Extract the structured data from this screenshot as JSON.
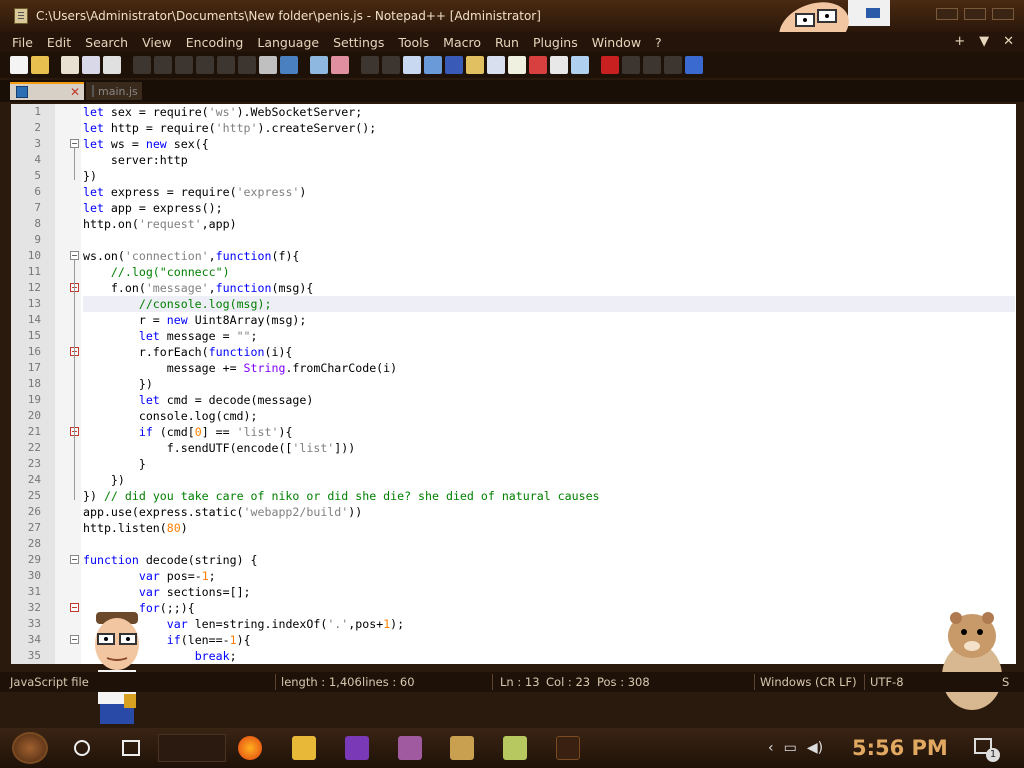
{
  "colors": {
    "accent": "#f39c12",
    "keyword": "#0000ff",
    "string": "#808080",
    "comment": "#008000",
    "number": "#ff8000",
    "builtin": "#8000ff"
  },
  "window": {
    "title": "C:\\Users\\Administrator\\Documents\\New folder\\penis.js - Notepad++ [Administrator]"
  },
  "menu": [
    "File",
    "Edit",
    "Search",
    "View",
    "Encoding",
    "Language",
    "Settings",
    "Tools",
    "Macro",
    "Run",
    "Plugins",
    "Window",
    "?"
  ],
  "menu_right": {
    "plus": "+",
    "dropdown": "▼",
    "close": "✕"
  },
  "tabs": [
    {
      "label": "",
      "active": true
    },
    {
      "label": "main.js",
      "active": false
    }
  ],
  "editor": {
    "current_line": 13,
    "lines": [
      "let sex = require('ws').WebSocketServer;",
      "let http = require('http').createServer();",
      "let ws = new sex({",
      "    server:http",
      "})",
      "let express = require('express')",
      "let app = express();",
      "http.on('request',app)",
      "",
      "ws.on('connection',function(f){",
      "    //.log(\"connecc\")",
      "    f.on('message',function(msg){",
      "        //console.log(msg);",
      "        r = new Uint8Array(msg);",
      "        let message = \"\";",
      "        r.forEach(function(i){",
      "            message += String.fromCharCode(i)",
      "        })",
      "        let cmd = decode(message)",
      "        console.log(cmd);",
      "        if (cmd[0] == 'list'){",
      "            f.sendUTF(encode(['list']))",
      "        }",
      "    })",
      "}) // did you take care of niko or did she die? she died of natural causes",
      "app.use(express.static('webapp2/build'))",
      "http.listen(80)",
      "",
      "function decode(string) {",
      "        var pos=-1;",
      "        var sections=[];",
      "        for(;;){",
      "            var len=string.indexOf('.',pos+1);",
      "            if(len==-1){",
      "                break;"
    ]
  },
  "status": {
    "language": "JavaScript file",
    "length": "length : 1,406",
    "lines": "lines : 60",
    "ln": "Ln : 13",
    "col": "Col : 23",
    "pos": "Pos : 308",
    "eol": "Windows (CR LF)",
    "encoding": "UTF-8",
    "mode": "S"
  },
  "taskbar": {
    "time": "5:56 PM",
    "notifications": "1"
  }
}
